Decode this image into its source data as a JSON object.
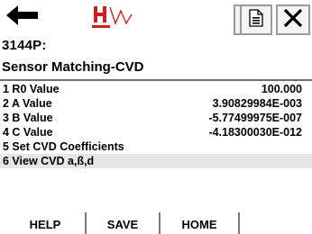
{
  "toolbar": {
    "back_icon": "left-arrow-icon",
    "logo_icon": "hart-logo-icon",
    "next_icon": "double-chevron-right-icon",
    "doc_icon": "document-icon",
    "close_icon": "close-icon"
  },
  "header": {
    "device_tag": "3144P:",
    "title": "Sensor Matching-CVD"
  },
  "menu": {
    "items": [
      {
        "label": "1 R0 Value",
        "value": "100.000"
      },
      {
        "label": "2 A Value",
        "value": "3.90829984E-003"
      },
      {
        "label": "3 B Value",
        "value": "-5.77499975E-007"
      },
      {
        "label": "4 C Value",
        "value": "-4.18300030E-012"
      },
      {
        "label": "5 Set CVD Coefficients",
        "value": ""
      },
      {
        "label": "6 View CVD a,ß,d",
        "value": ""
      }
    ]
  },
  "softkeys": {
    "help": "HELP",
    "save": "SAVE",
    "home": "HOME"
  },
  "colors": {
    "logo_red": "#cc2020",
    "next_blue": "#1a2ab0",
    "highlight": "#e6e6e6"
  }
}
